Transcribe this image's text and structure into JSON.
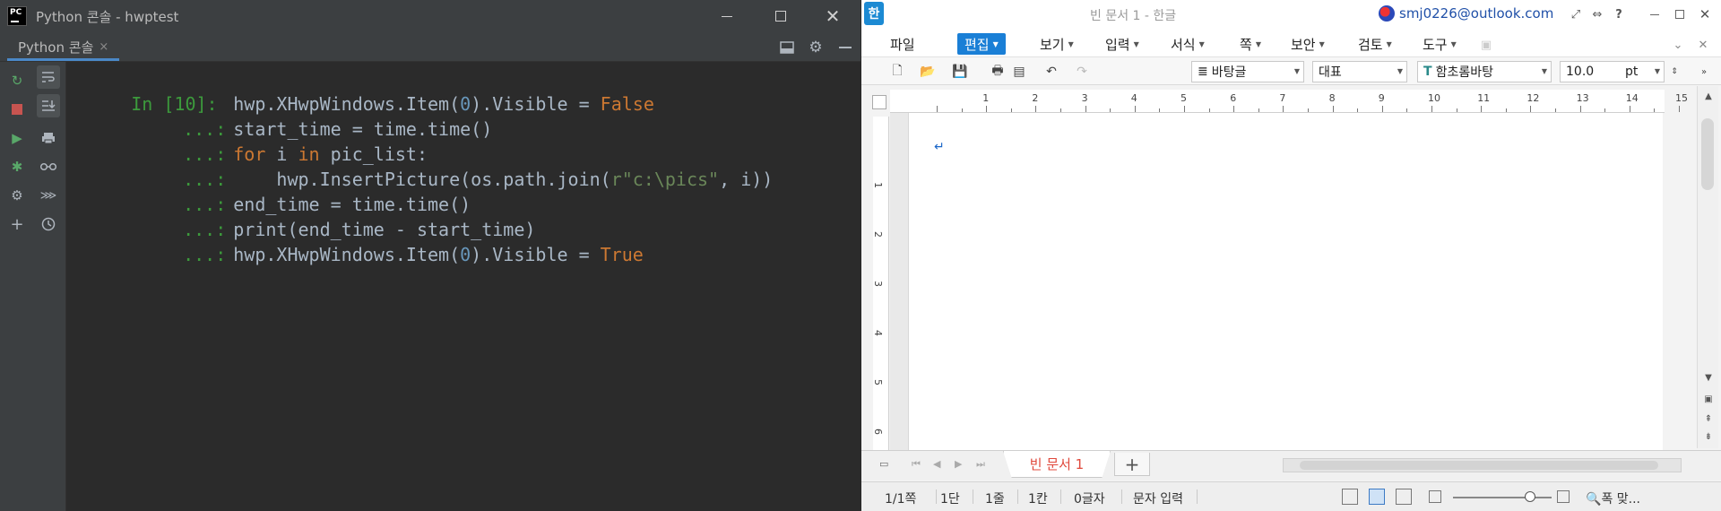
{
  "pycharm": {
    "title": "Python 콘솔 - hwptest",
    "tab_label": "Python 콘솔",
    "tab_close": "×",
    "prompt_first": "In [10]:",
    "prompt_cont": "...:",
    "code": {
      "l1_a": "hwp.XHwpWindows.Item(",
      "l1_num": "0",
      "l1_b": ").Visible = ",
      "l1_kw": "False",
      "l2": "start_time = time.time()",
      "l3_kw1": "for",
      "l3_a": " i ",
      "l3_kw2": "in",
      "l3_b": " pic_list:",
      "l4_a": "    hwp.InsertPicture(os.path.join(",
      "l4_str": "r\"c:\\pics\"",
      "l4_b": ", i))",
      "l5": "end_time = time.time()",
      "l6": "print(end_time - start_time)",
      "l7_a": "hwp.XHwpWindows.Item(",
      "l7_num": "0",
      "l7_b": ").Visible = ",
      "l7_kw": "True"
    }
  },
  "hwp": {
    "logo": "한",
    "title": "빈 문서 1 - 한글",
    "account": "smj0226@outlook.com",
    "menus": [
      "파일",
      "편집",
      "보기",
      "입력",
      "서식",
      "쪽",
      "보안",
      "검토",
      "도구"
    ],
    "style_select": "바탕글",
    "lang_select": "대표",
    "font_select": "함초롬바탕",
    "size_value": "10.0",
    "size_unit": "pt",
    "ruler": [
      "1",
      "2",
      "3",
      "4",
      "5",
      "6",
      "7",
      "8",
      "9",
      "10",
      "11",
      "12",
      "13",
      "14",
      "15"
    ],
    "vruler": [
      "1",
      "2",
      "3",
      "4",
      "5",
      "6"
    ],
    "para_mark": "↵",
    "doc_tab": "빈 문서 1",
    "add_tab": "+",
    "status": {
      "page": "1/1쪽",
      "section": "1단",
      "line": "1줄",
      "col": "1칸",
      "chars": "0글자",
      "mode": "문자 입력",
      "zoom": "폭 맞..."
    }
  }
}
